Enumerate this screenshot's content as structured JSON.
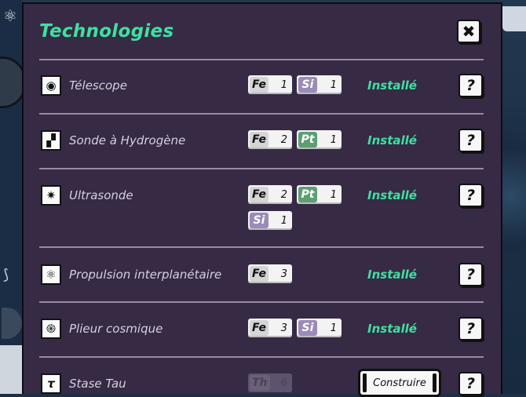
{
  "dialog": {
    "title": "Technologies",
    "close_icon": "close-icon",
    "technologies": [
      {
        "icon": "telescope-icon",
        "name": "Télescope",
        "resources": [
          {
            "symbol": "Fe",
            "qty": "1"
          },
          {
            "symbol": "Si",
            "qty": "1"
          }
        ],
        "status": "Installé",
        "help": "?"
      },
      {
        "icon": "hydrogen-probe-icon",
        "name": "Sonde à Hydrogène",
        "resources": [
          {
            "symbol": "Fe",
            "qty": "2"
          },
          {
            "symbol": "Pt",
            "qty": "1"
          }
        ],
        "status": "Installé",
        "help": "?"
      },
      {
        "icon": "ultrasound-icon",
        "name": "Ultrasonde",
        "resources": [
          {
            "symbol": "Fe",
            "qty": "2"
          },
          {
            "symbol": "Pt",
            "qty": "1"
          },
          {
            "symbol": "Si",
            "qty": "1"
          }
        ],
        "status": "Installé",
        "help": "?"
      },
      {
        "icon": "atom-icon",
        "name": "Propulsion interplanétaire",
        "resources": [
          {
            "symbol": "Fe",
            "qty": "3"
          }
        ],
        "status": "Installé",
        "help": "?"
      },
      {
        "icon": "spiral-icon",
        "name": "Plieur cosmique",
        "resources": [
          {
            "symbol": "Fe",
            "qty": "3"
          },
          {
            "symbol": "Si",
            "qty": "1"
          }
        ],
        "status": "Installé",
        "help": "?"
      },
      {
        "icon": "tau-icon",
        "name": "Stase Tau",
        "resources": [
          {
            "symbol": "Th",
            "qty": "6"
          }
        ],
        "build_label": "Construire",
        "help": "?"
      }
    ]
  },
  "colors": {
    "panel": "#372a45",
    "accent_green": "#3fe0a0",
    "silicon": "#9b8bb8",
    "platinum": "#5d9f73",
    "iron": "#d5d5d5"
  }
}
